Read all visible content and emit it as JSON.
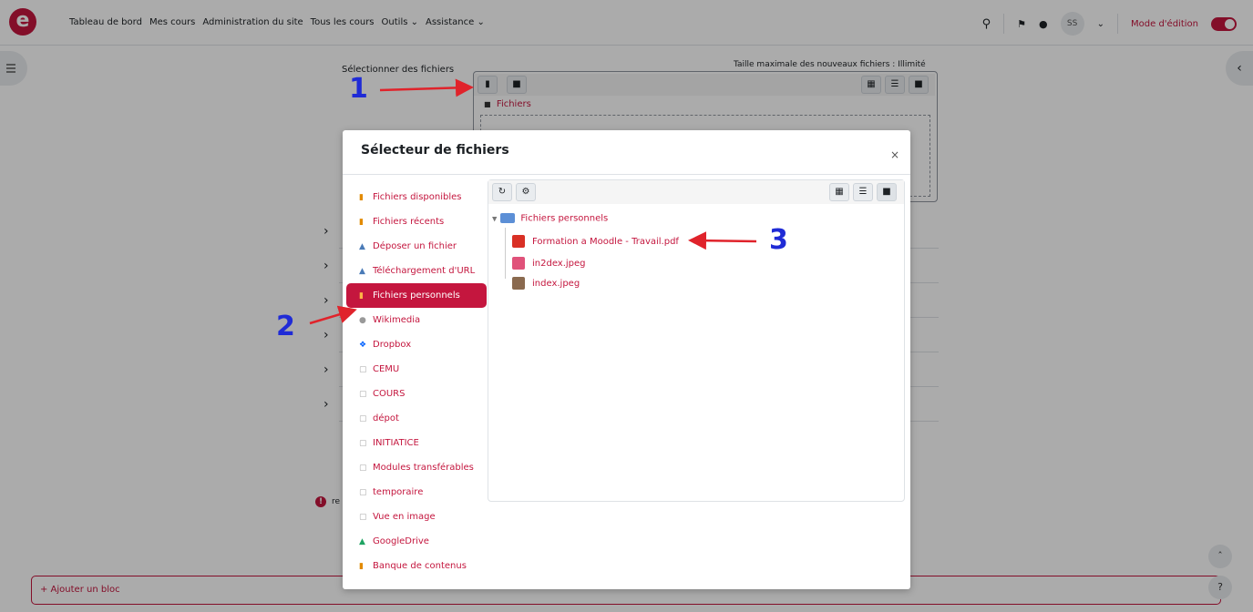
{
  "navbar": {
    "logo": "e",
    "links": [
      "Tableau de bord",
      "Mes cours",
      "Administration du site",
      "Tous les cours",
      "Outils ⌄",
      "Assistance ⌄"
    ],
    "user_initials": "SS",
    "edit_mode_label": "Mode d'édition"
  },
  "page": {
    "select_files_label": "Sélectionner des fichiers",
    "max_size_label": "Taille maximale des nouveaux fichiers : Illimité",
    "path_label": "Fichiers",
    "add_block_label": "+ Ajouter un bloc",
    "error_text": "re"
  },
  "modal": {
    "title": "Sélecteur de fichiers",
    "close": "×",
    "repositories": [
      {
        "label": "Fichiers disponibles",
        "icon": "repo-icon"
      },
      {
        "label": "Fichiers récents",
        "icon": "repo-icon"
      },
      {
        "label": "Déposer un fichier",
        "icon": "upload-icon"
      },
      {
        "label": "Téléchargement d'URL",
        "icon": "url-icon"
      },
      {
        "label": "Fichiers personnels",
        "icon": "repo-icon",
        "active": true
      },
      {
        "label": "Wikimedia",
        "icon": "wikimedia-icon"
      },
      {
        "label": "Dropbox",
        "icon": "dropbox-icon"
      },
      {
        "label": "CEMU",
        "icon": "folder-icon"
      },
      {
        "label": "COURS",
        "icon": "folder-icon"
      },
      {
        "label": "dépot",
        "icon": "folder-icon"
      },
      {
        "label": "INITIATICE",
        "icon": "folder-icon"
      },
      {
        "label": "Modules transférables",
        "icon": "folder-icon"
      },
      {
        "label": "temporaire",
        "icon": "folder-icon"
      },
      {
        "label": "Vue en image",
        "icon": "folder-icon"
      },
      {
        "label": "GoogleDrive",
        "icon": "googledrive-icon"
      },
      {
        "label": "Banque de contenus",
        "icon": "repo-icon"
      }
    ],
    "tree_root": "Fichiers personnels",
    "files": [
      "Formation a Moodle - Travail.pdf",
      "in2dex.jpeg",
      "index.jpeg"
    ]
  },
  "annotations": [
    "1",
    "2",
    "3"
  ],
  "colors": {
    "accent": "#c4163e",
    "annotation": "#1f2bd6",
    "arrow": "#e0232b"
  }
}
